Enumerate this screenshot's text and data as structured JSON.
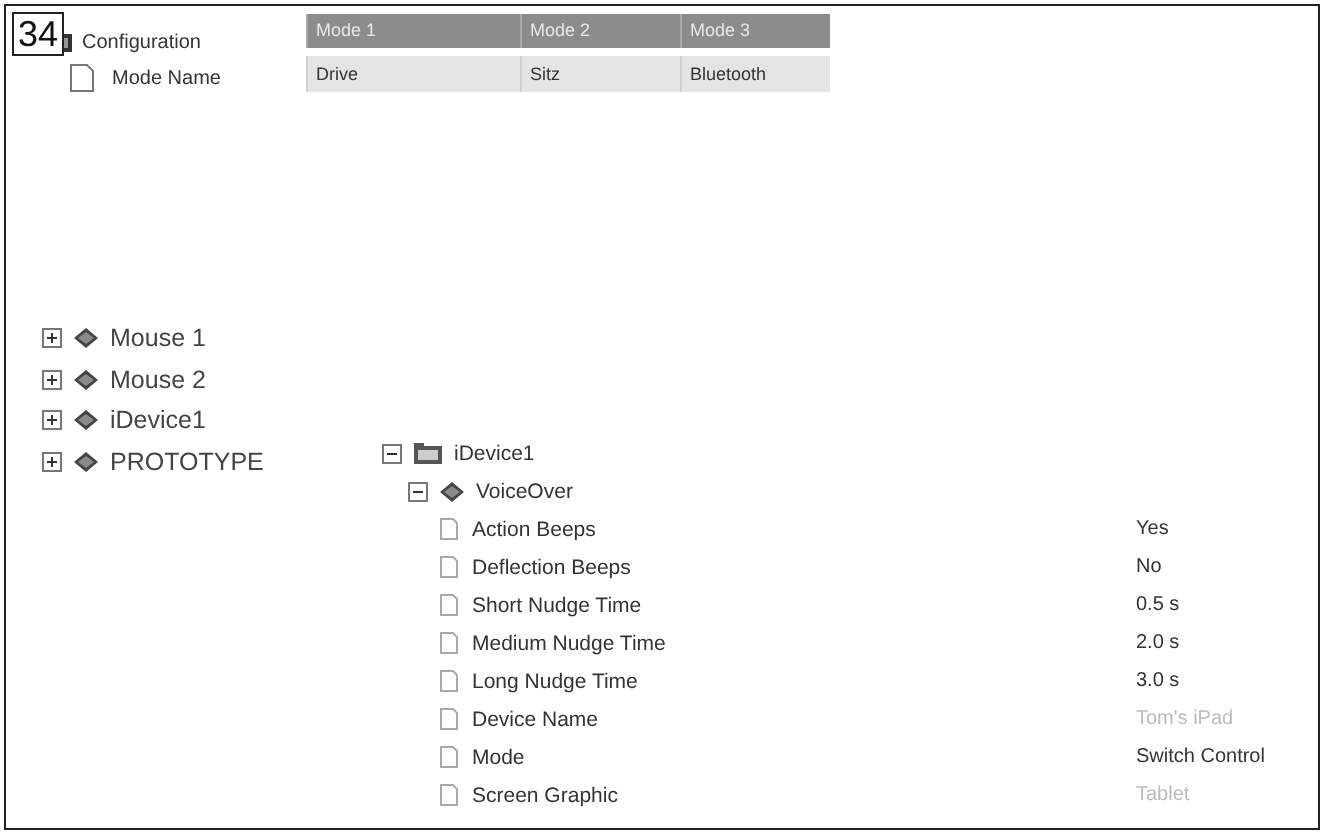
{
  "figure_label": "34",
  "config": {
    "title": "Configuration",
    "field": "Mode Name",
    "columns": [
      "Mode 1",
      "Mode 2",
      "Mode 3"
    ],
    "values": [
      "Drive",
      "Sitz",
      "Bluetooth"
    ]
  },
  "devices": [
    {
      "name": "Mouse 1",
      "expanded": false
    },
    {
      "name": "Mouse 2",
      "expanded": false
    },
    {
      "name": "iDevice1",
      "expanded": false
    },
    {
      "name": "PROTOTYPE",
      "expanded": false
    }
  ],
  "detail": {
    "name": "iDevice1",
    "expanded": true,
    "group": {
      "name": "VoiceOver",
      "expanded": true,
      "properties": [
        {
          "name": "Action Beeps",
          "value": "Yes",
          "disabled": false
        },
        {
          "name": "Deflection Beeps",
          "value": "No",
          "disabled": false
        },
        {
          "name": "Short Nudge Time",
          "value": "0.5 s",
          "disabled": false
        },
        {
          "name": "Medium Nudge Time",
          "value": "2.0 s",
          "disabled": false
        },
        {
          "name": "Long Nudge Time",
          "value": "3.0 s",
          "disabled": false
        },
        {
          "name": "Device Name",
          "value": "Tom's iPad",
          "disabled": true
        },
        {
          "name": "Mode",
          "value": "Switch Control",
          "disabled": false
        },
        {
          "name": "Screen Graphic",
          "value": "Tablet",
          "disabled": true
        }
      ]
    }
  }
}
